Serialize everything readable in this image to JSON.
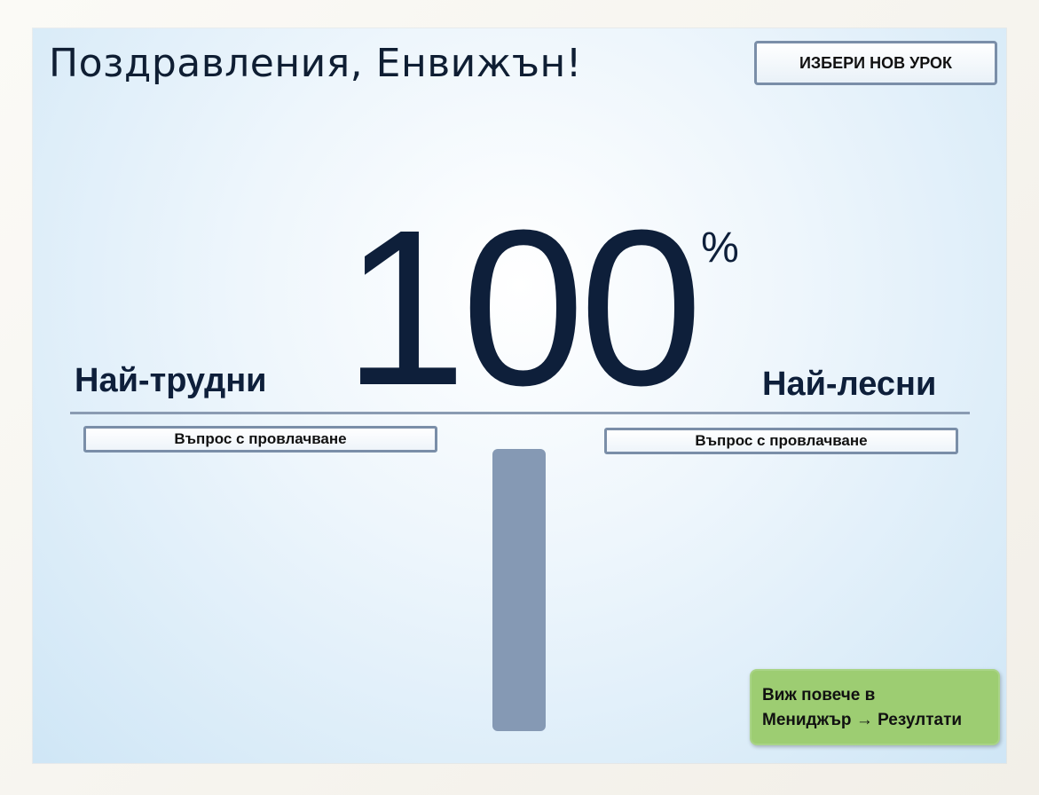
{
  "header": {
    "title": "Поздравления, Енвижън!",
    "new_lesson_label": "ИЗБЕРИ НОВ УРОК"
  },
  "score": {
    "value": "100",
    "unit": "%"
  },
  "labels": {
    "hardest": "Най-трудни",
    "easiest": "Най-лесни"
  },
  "questions": {
    "hardest_button": "Въпрос с провлачване",
    "easiest_button": "Въпрос с провлачване"
  },
  "progress_bar": {
    "fill_fraction": 1.0,
    "color": "#8599b4"
  },
  "footer": {
    "line1": "Виж повече в",
    "line2": "Мениджър → Резултати"
  },
  "colors": {
    "text": "#0e1f3a",
    "info_box": "#9dcd72",
    "border": "#7a8ea8"
  }
}
